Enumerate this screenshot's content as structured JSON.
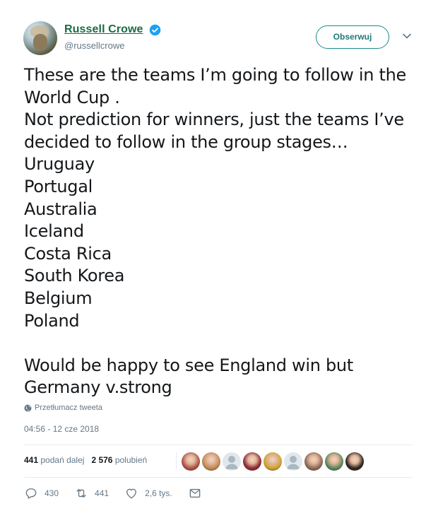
{
  "author": {
    "name": "Russell Crowe",
    "handle": "@russellcrowe",
    "verified": true,
    "link_color": "#1a6c45"
  },
  "follow_button": {
    "label": "Obserwuj"
  },
  "tweet": {
    "lines": [
      "These are the teams I’m going to follow in the",
      "World Cup .",
      "Not prediction for winners, just the teams I’ve",
      "decided to follow in the group stages…",
      "Uruguay",
      "Portugal",
      "Australia",
      "Iceland",
      "Costa Rica",
      "South Korea",
      "Belgium",
      "Poland",
      "",
      "Would be happy to see England win but",
      "Germany v.strong"
    ]
  },
  "translate_label": "Przetłumacz tweeta",
  "timestamp": "04:56 - 12 cze 2018",
  "stats": {
    "retweets_count": "441",
    "retweets_label": "podań dalej",
    "likes_count": "2 576",
    "likes_label": "polubień"
  },
  "liker_avatars": [
    {
      "icon": "avatar-photo",
      "color": "#b0524a"
    },
    {
      "icon": "avatar-photo",
      "color": "#c08a57"
    },
    {
      "icon": "avatar-default",
      "color": "#aab8c2"
    },
    {
      "icon": "avatar-photo",
      "color": "#8e2b3b"
    },
    {
      "icon": "avatar-photo",
      "color": "#d0a531"
    },
    {
      "icon": "avatar-default",
      "color": "#aab8c2"
    },
    {
      "icon": "avatar-photo",
      "color": "#8c6c5c"
    },
    {
      "icon": "avatar-photo",
      "color": "#5b8a5e"
    },
    {
      "icon": "avatar-photo",
      "color": "#2e2420"
    }
  ],
  "actions": {
    "reply_count": "430",
    "retweet_count": "441",
    "like_count": "2,6 tys."
  }
}
